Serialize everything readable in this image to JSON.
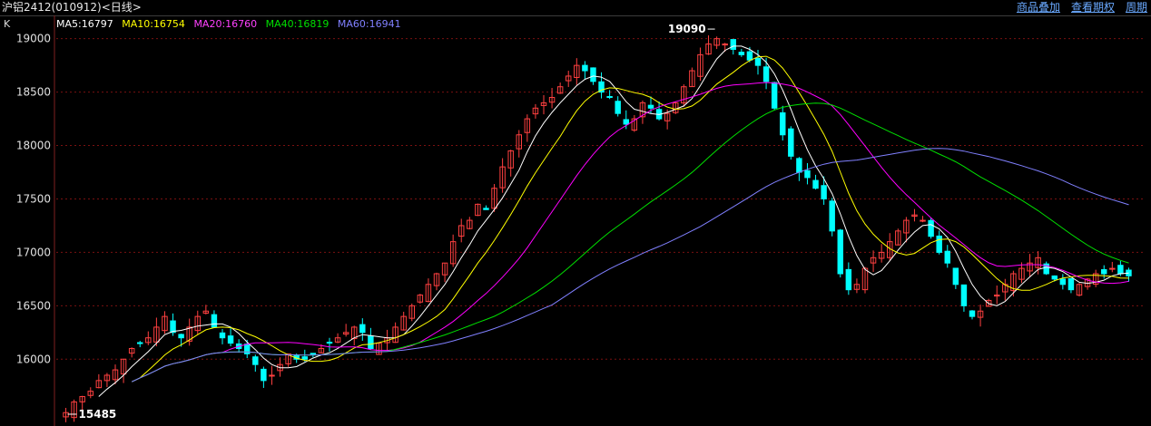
{
  "header": {
    "title": "沪铝2412(010912)<日线>",
    "links": [
      "商品叠加",
      "查看期权",
      "周期"
    ]
  },
  "legend": {
    "k_label": "K",
    "items": [
      {
        "label": "MA5:16797",
        "color": "#ffffff"
      },
      {
        "label": "MA10:16754",
        "color": "#ffff00"
      },
      {
        "label": "MA20:16760",
        "color": "#ff00ff"
      },
      {
        "label": "MA40:16819",
        "color": "#00e000"
      },
      {
        "label": "MA60:16941",
        "color": "#8080ff"
      }
    ]
  },
  "chart_data": {
    "type": "candlestick",
    "ylim": [
      15400,
      19150
    ],
    "yticks": [
      16000,
      16500,
      17000,
      17500,
      18000,
      18500,
      19000
    ],
    "grid": true,
    "up_color": "#ff4040",
    "down_color": "#00ffff",
    "annotations": [
      {
        "label": "19090",
        "value": 19090,
        "kind": "high"
      },
      {
        "label": "15485",
        "value": 15485,
        "kind": "low"
      }
    ],
    "closes": [
      15500,
      15600,
      15650,
      15700,
      15800,
      15850,
      15900,
      16000,
      16100,
      16150,
      16200,
      16300,
      16400,
      16250,
      16200,
      16300,
      16400,
      16450,
      16300,
      16200,
      16150,
      16100,
      16050,
      15950,
      15800,
      15850,
      15950,
      16050,
      16000,
      16000,
      16050,
      16100,
      16150,
      16200,
      16250,
      16300,
      16250,
      16100,
      16150,
      16200,
      16300,
      16400,
      16500,
      16600,
      16700,
      16800,
      16900,
      17100,
      17250,
      17300,
      17450,
      17400,
      17600,
      17800,
      17950,
      18100,
      18250,
      18350,
      18400,
      18450,
      18550,
      18650,
      18750,
      18700,
      18600,
      18500,
      18450,
      18300,
      18200,
      18250,
      18400,
      18350,
      18250,
      18300,
      18400,
      18550,
      18700,
      18850,
      18950,
      19000,
      18950,
      18900,
      18850,
      18800,
      18750,
      18600,
      18350,
      18100,
      17900,
      17750,
      17700,
      17600,
      17500,
      17200,
      16800,
      16650,
      16700,
      16850,
      16950,
      17000,
      17100,
      17200,
      17300,
      17350,
      17300,
      17150,
      17000,
      16900,
      16700,
      16500,
      16400,
      16450,
      16550,
      16600,
      16700,
      16800,
      16850,
      16900,
      16950,
      16800,
      16750,
      16700,
      16650,
      16700,
      16750,
      16800,
      16800,
      16850,
      16800,
      16780
    ],
    "ma_lines": [
      {
        "name": "MA5",
        "color": "#ffffff",
        "values": [
          16797
        ]
      },
      {
        "name": "MA10",
        "color": "#ffff00",
        "values": [
          16754
        ]
      },
      {
        "name": "MA20",
        "color": "#ff00ff",
        "values": [
          16760
        ]
      },
      {
        "name": "MA40",
        "color": "#00e000",
        "values": [
          16819
        ]
      },
      {
        "name": "MA60",
        "color": "#8080ff",
        "values": [
          16941
        ]
      }
    ]
  }
}
